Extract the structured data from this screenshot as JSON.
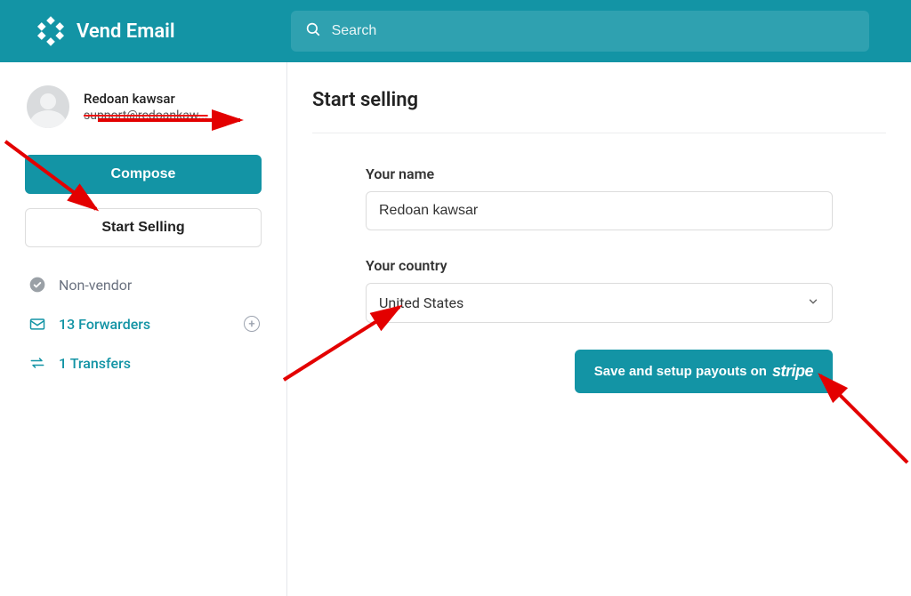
{
  "header": {
    "brand": "Vend Email",
    "search_placeholder": "Search"
  },
  "sidebar": {
    "profile": {
      "name": "Redoan kawsar",
      "email": "support@redoankaw..."
    },
    "compose_label": "Compose",
    "start_selling_label": "Start Selling",
    "nav": {
      "non_vendor": "Non-vendor",
      "forwarders": "13 Forwarders",
      "transfers": "1 Transfers"
    }
  },
  "main": {
    "title": "Start selling",
    "your_name_label": "Your name",
    "your_name_value": "Redoan kawsar",
    "your_country_label": "Your country",
    "your_country_value": "United States",
    "save_button_prefix": "Save and setup payouts on",
    "save_button_brand": "stripe"
  }
}
